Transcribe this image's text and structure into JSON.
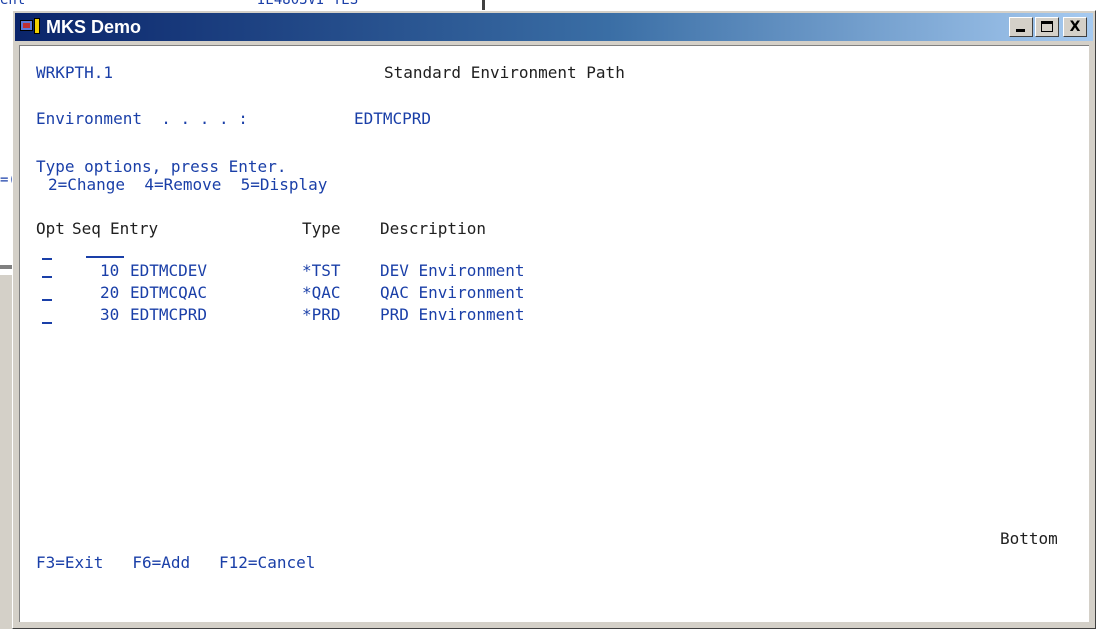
{
  "background_window": {
    "fragment_left": "ent",
    "fragment_right": "IE4803VI YES",
    "fragment_mid": "=("
  },
  "window": {
    "title": "MKS Demo",
    "controls": {
      "minimize": "_",
      "maximize": "□",
      "close": "X"
    }
  },
  "screen": {
    "program_id": "WRKPTH.1",
    "heading": "Standard Environment Path",
    "environment_label": "Environment  . . . . :",
    "environment_value": "EDTMCPRD",
    "instructions": "Type options, press Enter.",
    "options": "2=Change  4=Remove  5=Display",
    "columns": {
      "opt": "Opt",
      "seq": "Seq",
      "entry": "Entry",
      "type": "Type",
      "description": "Description"
    },
    "rows": [
      {
        "seq": "10",
        "entry": "EDTMCDEV",
        "type": "*TST",
        "description": "DEV Environment"
      },
      {
        "seq": "20",
        "entry": "EDTMCQAC",
        "type": "*QAC",
        "description": "QAC Environment"
      },
      {
        "seq": "30",
        "entry": "EDTMCPRD",
        "type": "*PRD",
        "description": "PRD Environment"
      }
    ],
    "bottom_indicator": "Bottom",
    "function_keys": "F3=Exit   F6=Add   F12=Cancel"
  },
  "colors": {
    "terminal_text": "#1a3fa8",
    "title_bar_start": "#0a246a",
    "title_bar_end": "#a6caf0"
  }
}
